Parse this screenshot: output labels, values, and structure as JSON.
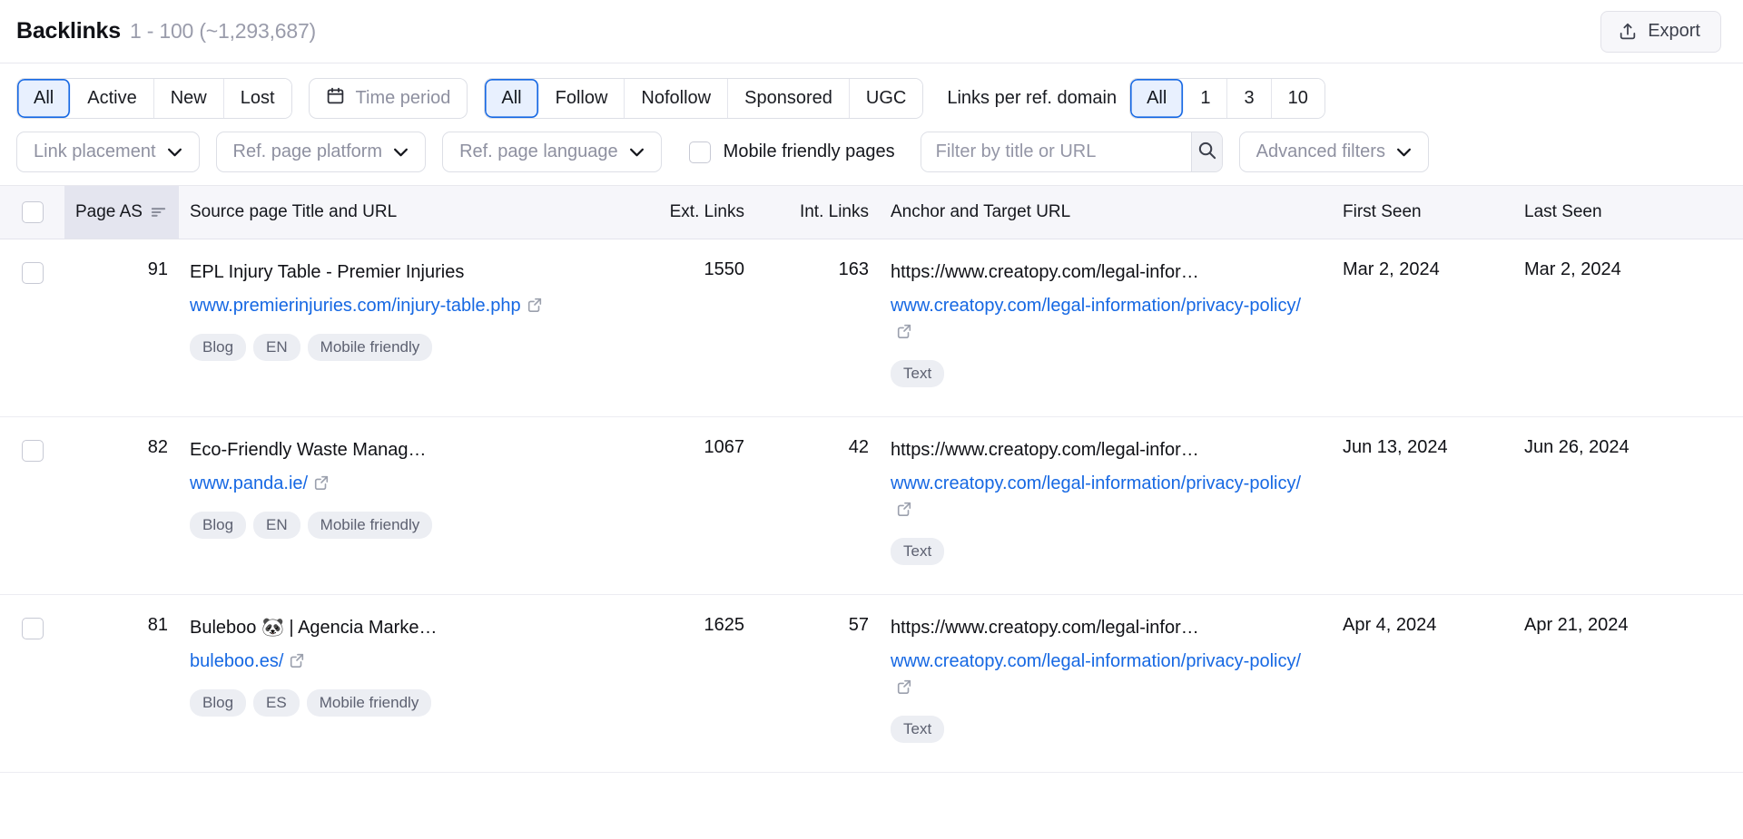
{
  "header": {
    "title": "Backlinks",
    "range_count": "1 - 100 (~1,293,687)",
    "export_label": "Export",
    "export_icon": "upload-icon"
  },
  "filters": {
    "status_segment": {
      "name": "status",
      "options": [
        "All",
        "Active",
        "New",
        "Lost"
      ],
      "selected": "All"
    },
    "time_period": {
      "label": "Time period",
      "icon": "calendar-icon"
    },
    "link_type_segment": {
      "name": "link-type",
      "options": [
        "All",
        "Follow",
        "Nofollow",
        "Sponsored",
        "UGC"
      ],
      "selected": "All"
    },
    "links_per_ref_domain": {
      "label": "Links per ref. domain",
      "options": [
        "All",
        "1",
        "3",
        "10"
      ],
      "selected": "All"
    },
    "link_placement": {
      "label": "Link placement",
      "icon": "chevron-down-icon"
    },
    "ref_page_platform": {
      "label": "Ref. page platform",
      "icon": "chevron-down-icon"
    },
    "ref_page_language": {
      "label": "Ref. page language",
      "icon": "chevron-down-icon"
    },
    "mobile_friendly": {
      "label": "Mobile friendly pages",
      "checked": false
    },
    "search": {
      "placeholder": "Filter by title or URL",
      "value": "",
      "icon": "search-icon"
    },
    "advanced_filters": {
      "label": "Advanced filters",
      "icon": "chevron-down-icon"
    }
  },
  "table": {
    "columns": {
      "page_as": "Page AS",
      "source": "Source page Title and URL",
      "ext_links": "Ext. Links",
      "int_links": "Int. Links",
      "anchor": "Anchor and Target URL",
      "first_seen": "First Seen",
      "last_seen": "Last Seen"
    },
    "sorted_column": "Page AS",
    "rows": [
      {
        "page_as": "91",
        "source_title": "EPL Injury Table - Premier Injuries",
        "source_url": "www.premierinjuries.com/injury-table.php",
        "source_tags": [
          "Blog",
          "EN",
          "Mobile friendly"
        ],
        "ext_links": "1550",
        "int_links": "163",
        "anchor_text": "https://www.creatopy.com/legal-infor…",
        "target_url": "www.creatopy.com/legal-information/privacy-policy/",
        "anchor_tags": [
          "Text"
        ],
        "first_seen": "Mar 2, 2024",
        "last_seen": "Mar 2, 2024"
      },
      {
        "page_as": "82",
        "source_title": "Eco-Friendly Waste Manag…",
        "source_url": "www.panda.ie/",
        "source_tags": [
          "Blog",
          "EN",
          "Mobile friendly"
        ],
        "ext_links": "1067",
        "int_links": "42",
        "anchor_text": "https://www.creatopy.com/legal-infor…",
        "target_url": "www.creatopy.com/legal-information/privacy-policy/",
        "anchor_tags": [
          "Text"
        ],
        "first_seen": "Jun 13, 2024",
        "last_seen": "Jun 26, 2024"
      },
      {
        "page_as": "81",
        "source_title": "Buleboo 🐼 | Agencia Marke…",
        "source_url": "buleboo.es/",
        "source_tags": [
          "Blog",
          "ES",
          "Mobile friendly"
        ],
        "ext_links": "1625",
        "int_links": "57",
        "anchor_text": "https://www.creatopy.com/legal-infor…",
        "target_url": "www.creatopy.com/legal-information/privacy-policy/",
        "anchor_tags": [
          "Text"
        ],
        "first_seen": "Apr 4, 2024",
        "last_seen": "Apr 21, 2024"
      }
    ]
  },
  "colors": {
    "accent": "#1668e3",
    "link": "#1668e3",
    "muted": "#9a9cab",
    "header_bg": "#f6f6fa",
    "sorted_bg": "#e4e5ef"
  }
}
